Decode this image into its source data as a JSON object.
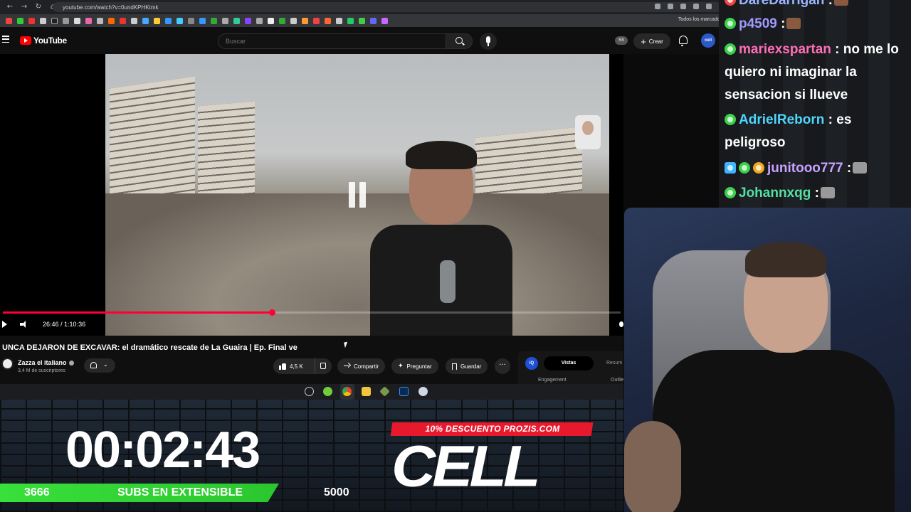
{
  "browser": {
    "url": "youtube.com/watch?v=0undKPHKtmk",
    "all_bookmarks": "Todos los marcador"
  },
  "youtube": {
    "logo_text": "YouTube",
    "search_placeholder": "Buscar",
    "ss_badge": "SS",
    "create_label": "Crear",
    "avatar_text": "cell"
  },
  "player": {
    "time_current": "26:46",
    "time_separator": " / ",
    "time_total": "1:10:36",
    "progress_fraction": 0.435
  },
  "video": {
    "title": "UNCA DEJARON DE EXCAVAR: el dramático rescate de La Guaira | Ep. Final ve",
    "channel_name": "Zazza el italiano",
    "subscribers": "3,4 M de suscriptores",
    "likes": "4,5 K",
    "share_label": "Compartir",
    "ask_label": "Preguntar",
    "save_label": "Guardar",
    "more_label": "···"
  },
  "side_panel": {
    "logo": "IQ",
    "tab_views": "Vistas",
    "tab_summary": "Resum",
    "engagement": "Engagement",
    "outliers": "Outlie"
  },
  "stream_overlay": {
    "timer": "00:02:43",
    "subs_current": "3666",
    "subs_label": "SUBS EN EXTENSIBLE",
    "subs_goal": "5000",
    "promo": "10% DESCUENTO PROZIS.COM",
    "brand": "CELL"
  },
  "chat": {
    "messages": [
      {
        "user": "DareDarrigan",
        "separator": " :",
        "text": "",
        "color": "#9ab6ff"
      },
      {
        "user": "p4509",
        "separator": " :",
        "text": "",
        "color": "#9f9bff"
      },
      {
        "user": "mariexspartan",
        "separator": " :",
        "text": " no me lo quiero ni imaginar la sensacion si llueve",
        "color": "#ff6fb5"
      },
      {
        "user": "AdrielReborn",
        "separator": " :",
        "text": " es peligroso",
        "color": "#4fd6ff"
      },
      {
        "user": "junitooo777",
        "separator": " :",
        "text": "",
        "color": "#c6a2ff"
      },
      {
        "user": "Johannxqg",
        "separator": " :",
        "text": "",
        "color": "#54e0a0"
      }
    ]
  },
  "colors": {
    "youtube_red": "#ff0000",
    "progress_red": "#ff0033",
    "subs_green": "#38e03a",
    "promo_red": "#e8192c",
    "chat_badge_green": "#3bd14a"
  },
  "icons": [
    "back-icon",
    "forward-icon",
    "reload-icon",
    "home-icon",
    "menu-icon",
    "search-icon",
    "microphone-icon",
    "plus-icon",
    "bell-icon",
    "pause-icon",
    "play-icon",
    "volume-icon",
    "verified-icon",
    "thumb-up-icon",
    "thumb-down-icon",
    "share-icon",
    "sparkle-icon",
    "bookmark-icon",
    "more-icon"
  ]
}
